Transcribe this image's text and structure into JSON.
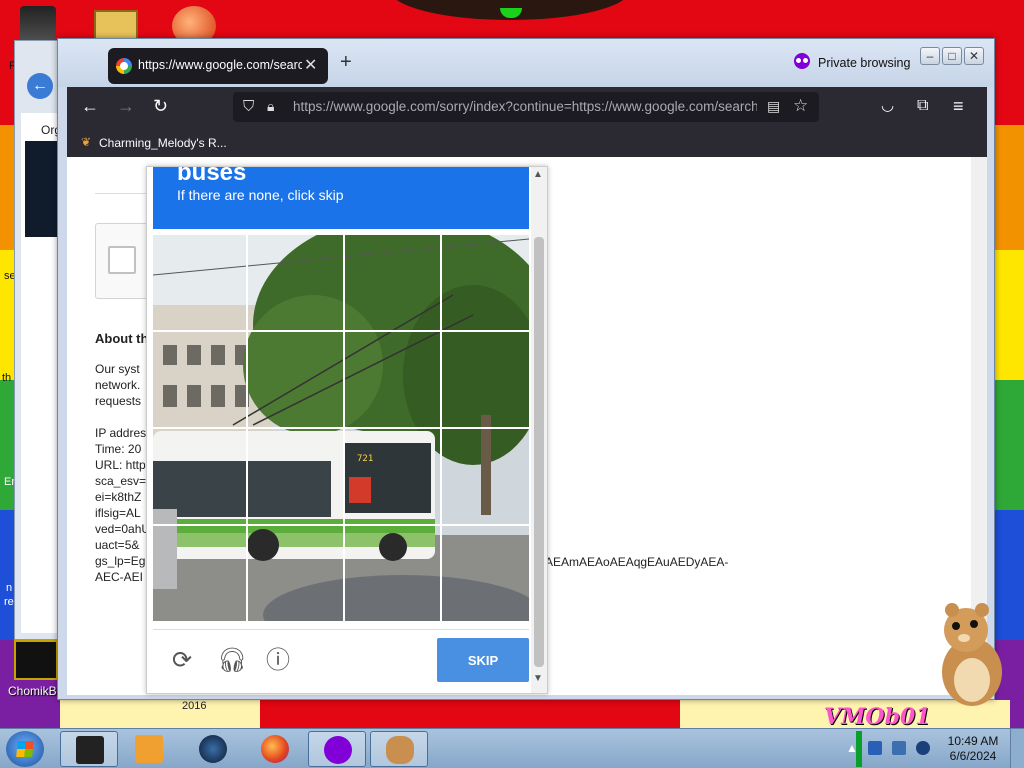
{
  "desktop": {
    "bottom_icon_label": "ChomikB",
    "year_text": "2016",
    "logo_text": "VMOb01",
    "edge_fragments": [
      "R",
      "Org",
      "se",
      "th",
      "Er",
      "n",
      "re"
    ]
  },
  "browser": {
    "tab_title": "https://www.google.com/search",
    "private_label": "Private browsing",
    "url": "https://www.google.com/sorry/index?continue=https://www.google.com/search",
    "bookmark_label": "Charming_Melody's R...",
    "window_buttons": [
      "minimize",
      "maximize",
      "close"
    ]
  },
  "page": {
    "about_heading": "About th",
    "paragraph_lines": [
      "Our syst",
      "network.",
      "requests"
    ],
    "info_lines": [
      "IP addres",
      "Time: 20",
      "URL: http",
      "sca_esv=",
      "ei=k8thZ",
      "iflsig=AL",
      "ved=0ahU",
      "uact=5&",
      "gs_lp=Eg",
      "AEC-AEI"
    ],
    "gs_lp_tail": "AEAmAEAoAEAqgEAuAEDyAEA-"
  },
  "captcha": {
    "title": "buses",
    "instruction": "If there are none, click skip",
    "skip_label": "SKIP",
    "bus_number_sign": "721"
  },
  "taskbar": {
    "time": "10:49 AM",
    "date": "6/6/2024"
  },
  "colors": {
    "captcha_blue": "#1a73e8",
    "skip_blue": "#4a90e2",
    "firefox_dark": "#2b2a33",
    "private_purple": "#8000d7"
  }
}
